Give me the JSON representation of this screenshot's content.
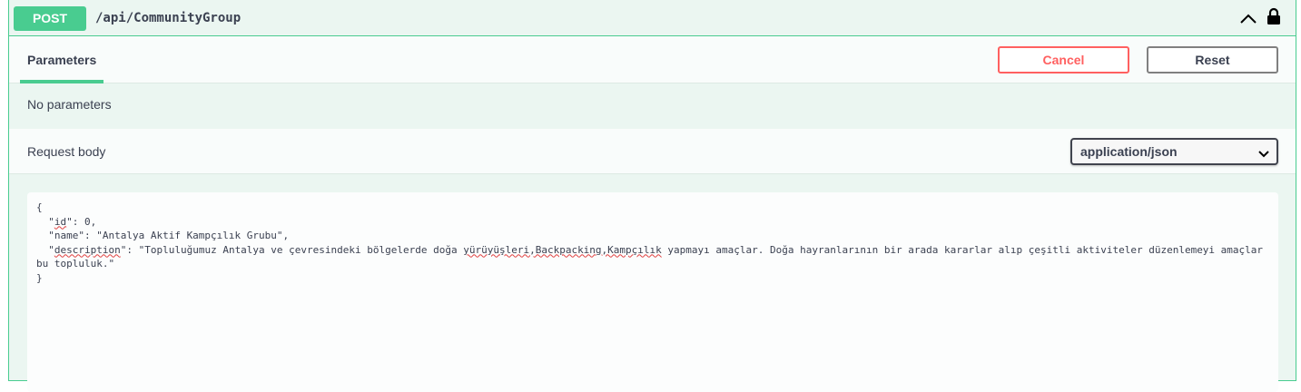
{
  "operation": {
    "method": "POST",
    "path": "/api/CommunityGroup",
    "expand_icon": "chevron-up-icon",
    "auth_icon": "lock-icon"
  },
  "parameters": {
    "tab_label": "Parameters",
    "cancel_label": "Cancel",
    "reset_label": "Reset",
    "empty_text": "No parameters"
  },
  "request_body": {
    "label": "Request body",
    "content_type": "application/json",
    "content_type_icon": "chevron-down-icon",
    "lines": [
      "{",
      "  \"id\": 0,",
      "  \"name\": \"Antalya Aktif Kampçılık Grubu\",",
      "  \"description\": \"Topluluğumuz Antalya ve çevresindeki bölgelerde doğa yürüyüşleri,Backpacking,Kampçılık yapmayı amaçlar. Doğa hayranlarının bir arada kararlar alıp çeşitli aktiviteler düzenlemeyi amaçlar",
      "bu topluluk.\"",
      "}"
    ]
  },
  "colors": {
    "post_green": "#49cc90",
    "cancel_red": "#ff6060",
    "panel_bg": "#ebf6f1"
  }
}
